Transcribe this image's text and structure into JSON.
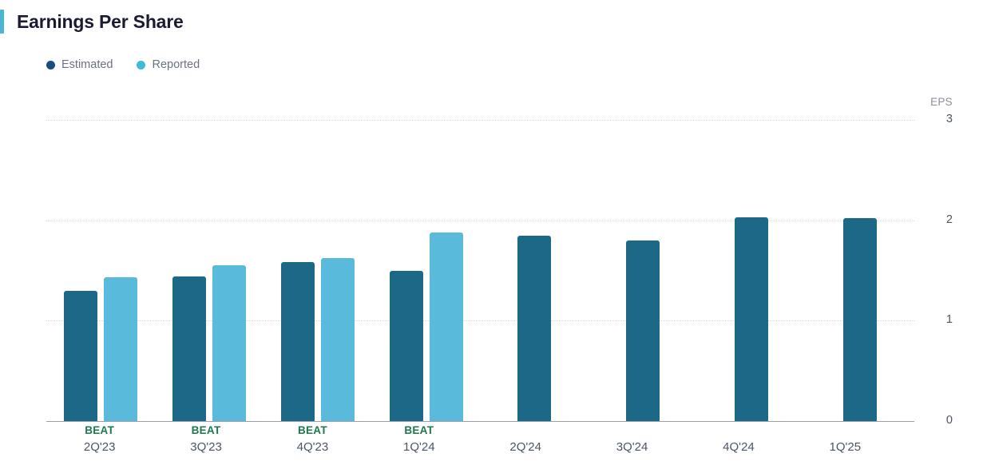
{
  "header": {
    "title": "Earnings Per Share",
    "accent_color": "#4BB3D4"
  },
  "legend": {
    "items": [
      {
        "label": "Estimated",
        "color": "#194C7F",
        "key": "estimated"
      },
      {
        "label": "Reported",
        "color": "#3DBBD9",
        "key": "reported"
      }
    ]
  },
  "chart_data": {
    "type": "bar",
    "title": "Earnings Per Share",
    "xlabel": "",
    "ylabel": "EPS",
    "unit_label": "EPS",
    "ylim": [
      0,
      3
    ],
    "yticks": [
      3,
      2,
      1,
      0
    ],
    "grid": true,
    "legend_position": "top-left",
    "categories": [
      "2Q'23",
      "3Q'23",
      "4Q'23",
      "1Q'24",
      "2Q'24",
      "3Q'24",
      "4Q'24",
      "1Q'25"
    ],
    "annotations": [
      "BEAT",
      "BEAT",
      "BEAT",
      "BEAT",
      "",
      "",
      "",
      ""
    ],
    "series": [
      {
        "name": "Estimated",
        "color": "#1B6887",
        "values": [
          1.3,
          1.44,
          1.58,
          1.5,
          1.85,
          1.8,
          2.03,
          2.02
        ]
      },
      {
        "name": "Reported",
        "color": "#59BADB",
        "values": [
          1.43,
          1.55,
          1.62,
          1.88,
          null,
          null,
          null,
          null
        ]
      }
    ]
  }
}
